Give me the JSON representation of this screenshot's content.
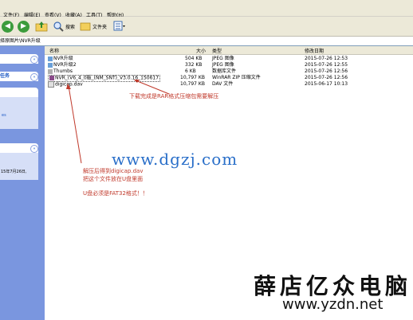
{
  "menu": {
    "items": [
      "文件(F)",
      "编辑(E)",
      "查看(V)",
      "收藏(A)",
      "工具(T)",
      "帮助(H)"
    ]
  },
  "toolbar": {
    "search_label": "搜索",
    "folders_label": "文件夹"
  },
  "address": {
    "path": "择原图片\\NVR升级"
  },
  "sidebar": {
    "panels": [
      {
        "title": ""
      },
      {
        "title": "任务"
      },
      {
        "title": ""
      },
      {
        "title": ""
      }
    ],
    "detail_text": "15年7月26日,",
    "detail_extra": "es"
  },
  "list": {
    "columns": [
      "名称",
      "大小",
      "类型",
      "修改日期"
    ],
    "rows": [
      {
        "name": "NVR升级",
        "size": "504 KB",
        "type": "JPEG 图像",
        "date": "2015-07-26 12:53"
      },
      {
        "name": "NVR升级2",
        "size": "332 KB",
        "type": "JPEG 图像",
        "date": "2015-07-26 12:55"
      },
      {
        "name": "Thumbs",
        "size": "6 KB",
        "type": "数据库文件",
        "date": "2015-07-26 12:56"
      },
      {
        "name": "NVR_(V6_4_0版_(NM_SNT)_V3.0.16_150617",
        "size": "10,797 KB",
        "type": "WinRAR ZIP 压缩文件",
        "date": "2015-07-26 12:56"
      },
      {
        "name": "digicap.dav",
        "size": "10,797 KB",
        "type": "DAV 文件",
        "date": "2015-06-17 10:13"
      }
    ]
  },
  "annotations": {
    "rar_note": "下载完成是RAR格式压缩包需要解压",
    "extract_note": "解压后得到digicap.dav",
    "copy_note": "把这个文件放在U盘里面",
    "fat32_note": "U盘必须是FAT32格式！！"
  },
  "watermark": {
    "url": "www.dgzj.com"
  },
  "brand": {
    "name": "薛店亿众电脑",
    "url": "www.yzdn.net"
  },
  "colors": {
    "sidebar": "#7a96df",
    "annotation": "#c0392b",
    "watermark": "#2a6fc9"
  }
}
